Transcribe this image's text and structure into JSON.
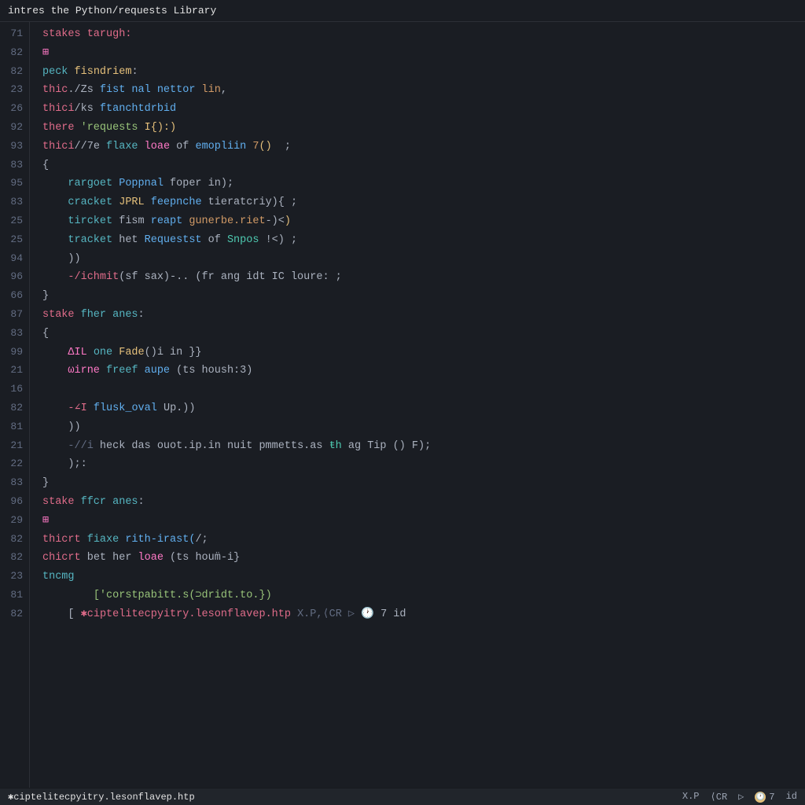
{
  "title": "intres the Python/requests Library",
  "lines": [
    {
      "num": "71",
      "code": [
        {
          "t": "stakes tarugh:",
          "c": "kw-pink"
        }
      ]
    },
    {
      "num": "82",
      "code": [
        {
          "t": "⊞",
          "c": "kw-magenta"
        }
      ]
    },
    {
      "num": "82",
      "code": [
        {
          "t": "peck ",
          "c": "kw-cyan"
        },
        {
          "t": "fisndriem",
          "c": "kw-yellow"
        },
        {
          "t": ":",
          "c": "kw-white"
        }
      ]
    },
    {
      "num": "23",
      "code": [
        {
          "t": "thic",
          "c": "kw-pink"
        },
        {
          "t": "./Zs ",
          "c": "kw-white"
        },
        {
          "t": "fist nal nettor ",
          "c": "kw-blue"
        },
        {
          "t": "lin",
          "c": "kw-orange"
        },
        {
          "t": ",",
          "c": "kw-white"
        }
      ]
    },
    {
      "num": "26",
      "code": [
        {
          "t": "thici",
          "c": "kw-pink"
        },
        {
          "t": "/ks ",
          "c": "kw-white"
        },
        {
          "t": "ftanchtdrbid",
          "c": "kw-blue"
        }
      ]
    },
    {
      "num": "92",
      "code": [
        {
          "t": "there ",
          "c": "kw-pink"
        },
        {
          "t": "'requests ",
          "c": "kw-green"
        },
        {
          "t": "I{):)",
          "c": "kw-yellow"
        }
      ]
    },
    {
      "num": "93",
      "code": [
        {
          "t": "thici",
          "c": "kw-pink"
        },
        {
          "t": "//7e ",
          "c": "kw-white"
        },
        {
          "t": "flaxe ",
          "c": "kw-cyan"
        },
        {
          "t": "loae ",
          "c": "kw-magenta"
        },
        {
          "t": "of ",
          "c": "kw-white"
        },
        {
          "t": "emopliin ",
          "c": "kw-blue"
        },
        {
          "t": "7",
          "c": "kw-orange"
        },
        {
          "t": "()",
          "c": "kw-yellow"
        },
        {
          "t": "  ;",
          "c": "kw-white"
        }
      ]
    },
    {
      "num": "83",
      "code": [
        {
          "t": "{",
          "c": "kw-white"
        }
      ]
    },
    {
      "num": "95",
      "code": [
        {
          "t": "    rargoet ",
          "c": "kw-cyan"
        },
        {
          "t": "Poppnal ",
          "c": "kw-blue"
        },
        {
          "t": "foper in",
          "c": "kw-white"
        },
        {
          "t": ");",
          "c": "kw-white"
        }
      ]
    },
    {
      "num": "83",
      "code": [
        {
          "t": "    cracket ",
          "c": "kw-cyan"
        },
        {
          "t": "JPRL ",
          "c": "kw-yellow"
        },
        {
          "t": "feepnche ",
          "c": "kw-blue"
        },
        {
          "t": "tieratcriy",
          "c": "kw-white"
        },
        {
          "t": "){ ;",
          "c": "kw-white"
        }
      ]
    },
    {
      "num": "25",
      "code": [
        {
          "t": "    tircket ",
          "c": "kw-cyan"
        },
        {
          "t": "fism ",
          "c": "kw-white"
        },
        {
          "t": "reapt ",
          "c": "kw-blue"
        },
        {
          "t": "gunerbe.riet",
          "c": "kw-orange"
        },
        {
          "t": "-)",
          "c": "kw-white"
        },
        {
          "t": "<",
          "c": "kw-white"
        },
        {
          "t": ")",
          "c": "kw-yellow"
        }
      ]
    },
    {
      "num": "25",
      "code": [
        {
          "t": "    tracket ",
          "c": "kw-cyan"
        },
        {
          "t": "het ",
          "c": "kw-white"
        },
        {
          "t": "Requestst ",
          "c": "kw-blue"
        },
        {
          "t": "of ",
          "c": "kw-white"
        },
        {
          "t": "Snpos ",
          "c": "kw-teal"
        },
        {
          "t": "!<) ;",
          "c": "kw-white"
        }
      ]
    },
    {
      "num": "94",
      "code": [
        {
          "t": "    ))",
          "c": "kw-white"
        }
      ]
    },
    {
      "num": "96",
      "code": [
        {
          "t": "    ",
          "c": "kw-white"
        },
        {
          "t": "-/ichmit",
          "c": "kw-pink"
        },
        {
          "t": "(sf sax)-.. (fr ang idt IC loure: ;",
          "c": "kw-white"
        }
      ]
    },
    {
      "num": "66",
      "code": [
        {
          "t": "}",
          "c": "kw-white"
        }
      ]
    },
    {
      "num": "87",
      "code": [
        {
          "t": "stake ",
          "c": "kw-pink"
        },
        {
          "t": "fher anes",
          "c": "kw-cyan"
        },
        {
          "t": ":",
          "c": "kw-white"
        }
      ]
    },
    {
      "num": "83",
      "code": [
        {
          "t": "{",
          "c": "kw-white"
        }
      ]
    },
    {
      "num": "99",
      "code": [
        {
          "t": "    ",
          "c": "kw-white"
        },
        {
          "t": "ΔIL ",
          "c": "kw-magenta"
        },
        {
          "t": "one ",
          "c": "kw-cyan"
        },
        {
          "t": "Fade",
          "c": "kw-yellow"
        },
        {
          "t": "()i in }}",
          "c": "kw-white"
        }
      ]
    },
    {
      "num": "21",
      "code": [
        {
          "t": "    ",
          "c": "kw-white"
        },
        {
          "t": "ωirne ",
          "c": "kw-magenta"
        },
        {
          "t": "freef ",
          "c": "kw-cyan"
        },
        {
          "t": "aupe ",
          "c": "kw-blue"
        },
        {
          "t": "(ts housh:3)",
          "c": "kw-white"
        }
      ]
    },
    {
      "num": "16",
      "code": [
        {
          "t": "",
          "c": "kw-white"
        }
      ]
    },
    {
      "num": "82",
      "code": [
        {
          "t": "    ",
          "c": "kw-white"
        },
        {
          "t": "-∠I ",
          "c": "kw-pink"
        },
        {
          "t": "flusk_oval ",
          "c": "kw-blue"
        },
        {
          "t": "Up.))",
          "c": "kw-white"
        }
      ]
    },
    {
      "num": "81",
      "code": [
        {
          "t": "    ))",
          "c": "kw-white"
        }
      ]
    },
    {
      "num": "21",
      "code": [
        {
          "t": "    ",
          "c": "kw-white"
        },
        {
          "t": "-//i ",
          "c": "kw-gray"
        },
        {
          "t": "heck das ouot.ip.in nuit pmmetts.as ",
          "c": "kw-white"
        },
        {
          "t": "ŧh ",
          "c": "kw-teal"
        },
        {
          "t": "ag Tip () F);",
          "c": "kw-white"
        }
      ]
    },
    {
      "num": "22",
      "code": [
        {
          "t": "    );",
          "c": "kw-white"
        },
        {
          "t": ":",
          "c": "kw-white"
        }
      ]
    },
    {
      "num": "83",
      "code": [
        {
          "t": "}",
          "c": "kw-white"
        }
      ]
    },
    {
      "num": "96",
      "code": [
        {
          "t": "stake ",
          "c": "kw-pink"
        },
        {
          "t": "ffcr anes",
          "c": "kw-cyan"
        },
        {
          "t": ":",
          "c": "kw-white"
        }
      ]
    },
    {
      "num": "29",
      "code": [
        {
          "t": "⊞",
          "c": "kw-magenta"
        }
      ]
    },
    {
      "num": "82",
      "code": [
        {
          "t": "thicrt ",
          "c": "kw-pink"
        },
        {
          "t": "fiaxe ",
          "c": "kw-cyan"
        },
        {
          "t": "rith-irast(",
          "c": "kw-blue"
        },
        {
          "t": "/;",
          "c": "kw-white"
        }
      ]
    },
    {
      "num": "82",
      "code": [
        {
          "t": "chicrt ",
          "c": "kw-pink"
        },
        {
          "t": "bet her ",
          "c": "kw-white"
        },
        {
          "t": "loae ",
          "c": "kw-magenta"
        },
        {
          "t": "(ts houm̈-i}",
          "c": "kw-white"
        }
      ]
    },
    {
      "num": "23",
      "code": [
        {
          "t": "tncmg",
          "c": "kw-cyan"
        }
      ]
    },
    {
      "num": "81",
      "code": [
        {
          "t": "        ",
          "c": "kw-white"
        },
        {
          "t": "['corstpabitt.s(⊃dridt.to.})",
          "c": "kw-green"
        }
      ]
    },
    {
      "num": "82",
      "code": [
        {
          "t": "    [ ",
          "c": "kw-white"
        },
        {
          "t": "✱ciptelitecpyitry.lesonflavep.htp",
          "c": "kw-pink"
        },
        {
          "t": " X.P,⟨CR ▷ ",
          "c": "kw-gray"
        },
        {
          "t": "🕐",
          "c": "kw-yellow"
        },
        {
          "t": " 7 id",
          "c": "kw-white"
        }
      ]
    }
  ],
  "status": {
    "file": "✱ciptelitecpyitry.lesonflavep.htp",
    "encoding": "X.P",
    "line_ending": "⟨CR",
    "play": "▷",
    "clock_num": "7",
    "id": "id"
  }
}
